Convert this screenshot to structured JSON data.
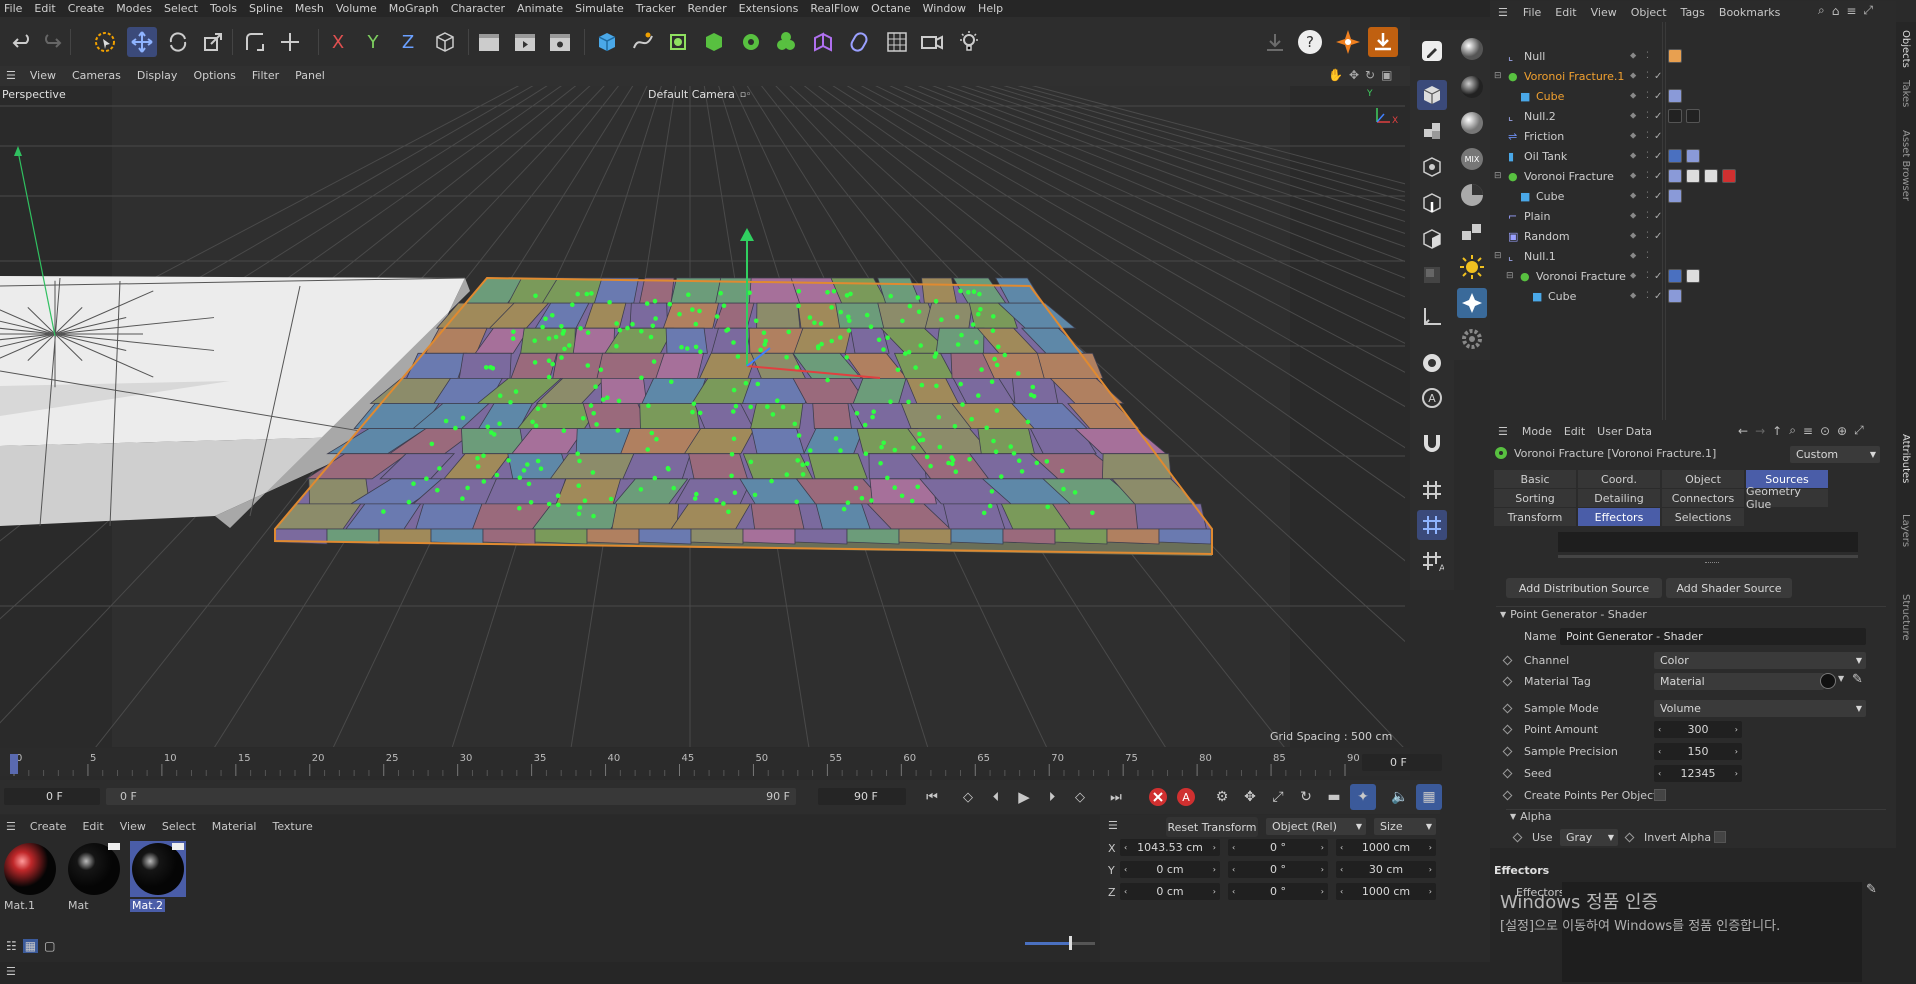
{
  "menubar": [
    "File",
    "Edit",
    "Create",
    "Modes",
    "Select",
    "Tools",
    "Spline",
    "Mesh",
    "Volume",
    "MoGraph",
    "Character",
    "Animate",
    "Simulate",
    "Tracker",
    "Render",
    "Extensions",
    "RealFlow",
    "Octane",
    "Window",
    "Help"
  ],
  "viewport": {
    "menu": [
      "View",
      "Cameras",
      "Display",
      "Options",
      "Filter",
      "Panel"
    ],
    "label": "Perspective",
    "camera": "Default Camera",
    "grid_spacing": "Grid Spacing : 500 cm",
    "axis_y": "Y",
    "axis_x": "X"
  },
  "timeline": {
    "ticks": [
      "0",
      "5",
      "10",
      "15",
      "20",
      "25",
      "30",
      "35",
      "40",
      "45",
      "50",
      "55",
      "60",
      "65",
      "70",
      "75",
      "80",
      "85",
      "90"
    ],
    "current_frame": "0 F",
    "start_field": "0 F",
    "range_start": "0 F",
    "range_end": "90 F",
    "end_field": "90 F"
  },
  "materials": {
    "menu": [
      "Create",
      "Edit",
      "View",
      "Select",
      "Material",
      "Texture"
    ],
    "items": [
      {
        "name": "Mat.1",
        "color": "#c0282a"
      },
      {
        "name": "Mat",
        "color": "#151515"
      },
      {
        "name": "Mat.2",
        "color": "#151515"
      }
    ]
  },
  "coords": {
    "reset": "Reset Transform",
    "mode": "Object (Rel)",
    "size_mode": "Size",
    "rows": [
      {
        "axis": "X",
        "pos": "1043.53 cm",
        "rot": "0 °",
        "size": "1000 cm"
      },
      {
        "axis": "Y",
        "pos": "0 cm",
        "rot": "0 °",
        "size": "30 cm"
      },
      {
        "axis": "Z",
        "pos": "0 cm",
        "rot": "0 °",
        "size": "1000 cm"
      }
    ]
  },
  "objmgr": {
    "menu": [
      "File",
      "Edit",
      "View",
      "Object",
      "Tags",
      "Bookmarks"
    ],
    "objects": [
      {
        "name": "Null",
        "indent": 0,
        "selected": false
      },
      {
        "name": "Voronoi Fracture.1",
        "indent": 0,
        "selected": true
      },
      {
        "name": "Cube",
        "indent": 1,
        "selected": true
      },
      {
        "name": "Null.2",
        "indent": 0,
        "selected": false
      },
      {
        "name": "Friction",
        "indent": 0,
        "selected": false
      },
      {
        "name": "Oil Tank",
        "indent": 0,
        "selected": false
      },
      {
        "name": "Voronoi Fracture",
        "indent": 0,
        "selected": false
      },
      {
        "name": "Cube",
        "indent": 1,
        "selected": false
      },
      {
        "name": "Plain",
        "indent": 0,
        "selected": false
      },
      {
        "name": "Random",
        "indent": 0,
        "selected": false
      },
      {
        "name": "Null.1",
        "indent": 0,
        "selected": false
      },
      {
        "name": "Voronoi Fracture",
        "indent": 1,
        "selected": false
      },
      {
        "name": "Cube",
        "indent": 2,
        "selected": false
      }
    ],
    "side_tabs": [
      "Objects",
      "Takes",
      "Asset Browser"
    ]
  },
  "attr": {
    "menu": [
      "Mode",
      "Edit",
      "User Data"
    ],
    "title": "Voronoi Fracture [Voronoi Fracture.1]",
    "preset": "Custom",
    "tabs_row1": [
      "Basic",
      "Coord.",
      "Object",
      "Sources"
    ],
    "tabs_row2": [
      "Sorting",
      "Detailing",
      "Connectors",
      "Geometry Glue"
    ],
    "tabs_row3": [
      "Transform",
      "Effectors",
      "Selections"
    ],
    "add_distribution": "Add Distribution Source",
    "add_shader": "Add Shader Source",
    "section": "Point Generator - Shader",
    "name_label": "Name",
    "name_value": "Point Generator - Shader",
    "channel_label": "Channel",
    "channel_value": "Color",
    "material_tag_label": "Material Tag",
    "material_tag_value": "Material",
    "sample_mode_label": "Sample Mode",
    "sample_mode_value": "Volume",
    "point_amount_label": "Point Amount",
    "point_amount_value": "300",
    "sample_precision_label": "Sample Precision",
    "sample_precision_value": "150",
    "seed_label": "Seed",
    "seed_value": "12345",
    "create_points_label": "Create Points Per Object",
    "alpha_section": "Alpha",
    "use_label": "Use",
    "use_value": "Gray",
    "invert_alpha_label": "Invert Alpha",
    "effectors_header": "Effectors",
    "effectors_label": "Effectors",
    "side_tabs": [
      "Attributes",
      "Layers",
      "Structure"
    ]
  },
  "watermark": {
    "title": "Windows 정품 인증",
    "sub": "[설정]으로 이동하여 Windows를 정품 인증합니다."
  }
}
